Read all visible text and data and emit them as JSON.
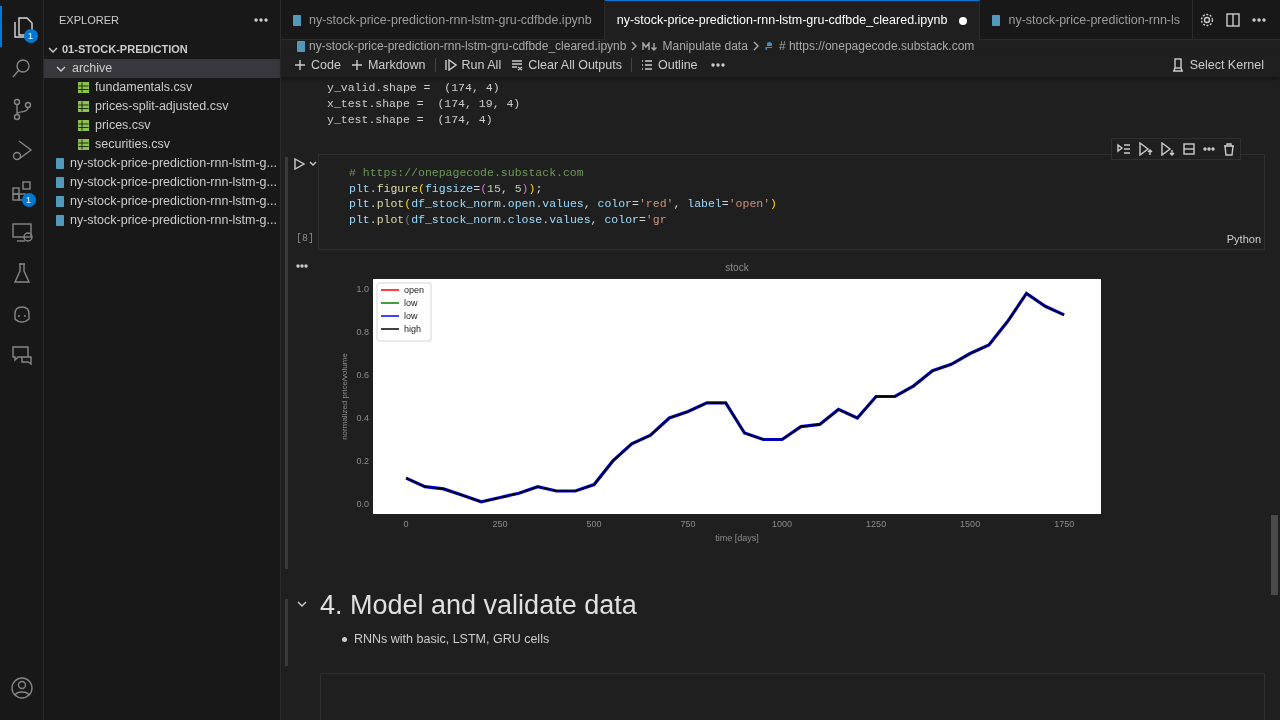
{
  "activity_bar": {
    "items": [
      {
        "kind": "files",
        "selected": true,
        "badge": "1"
      },
      {
        "kind": "search",
        "selected": false
      },
      {
        "kind": "source-control",
        "selected": false
      },
      {
        "kind": "run-debug",
        "selected": false
      },
      {
        "kind": "extensions",
        "selected": false,
        "badge": "1"
      },
      {
        "kind": "remote",
        "selected": false
      },
      {
        "kind": "testing",
        "selected": false
      },
      {
        "kind": "copilot",
        "selected": false
      },
      {
        "kind": "chat",
        "selected": false
      }
    ],
    "bottom": [
      {
        "kind": "account",
        "selected": false
      }
    ]
  },
  "sidebar": {
    "title": "EXPLORER",
    "folder": "01-STOCK-PREDICTION",
    "expanded": true,
    "items": [
      {
        "label": "archive",
        "kind": "folder",
        "expanded": true,
        "selected": true,
        "children": [
          {
            "label": "fundamentals.csv",
            "kind": "csv",
            "selected": false
          },
          {
            "label": "prices-split-adjusted.csv",
            "kind": "csv",
            "selected": false
          },
          {
            "label": "prices.csv",
            "kind": "csv",
            "selected": false
          },
          {
            "label": "securities.csv",
            "kind": "csv",
            "selected": false
          }
        ]
      },
      {
        "label": "ny-stock-price-prediction-rnn-lstm-g...",
        "kind": "notebook",
        "selected": false
      },
      {
        "label": "ny-stock-price-prediction-rnn-lstm-g...",
        "kind": "notebook",
        "selected": false
      },
      {
        "label": "ny-stock-price-prediction-rnn-lstm-g...",
        "kind": "notebook",
        "selected": false
      },
      {
        "label": "ny-stock-price-prediction-rnn-lstm-g...",
        "kind": "notebook",
        "selected": false
      }
    ]
  },
  "tabs": [
    {
      "label": "ny-stock-price-prediction-rnn-lstm-gru-cdfbde.ipynb",
      "selected": false,
      "dirty": false
    },
    {
      "label": "ny-stock-price-prediction-rnn-lstm-gru-cdfbde_cleared.ipynb",
      "selected": true,
      "dirty": true
    },
    {
      "label": "ny-stock-price-prediction-rnn-ls",
      "selected": false,
      "dirty": false
    }
  ],
  "breadcrumb": [
    {
      "label": "ny-stock-price-prediction-rnn-lstm-gru-cdfbde_cleared.ipynb",
      "kind": "notebook"
    },
    {
      "label": "Manipulate data",
      "kind": "markdown"
    },
    {
      "label": "# https://onepagecode.substack.com",
      "kind": "python"
    }
  ],
  "toolbar": {
    "items": [
      {
        "label": "Code",
        "kind": "add"
      },
      {
        "label": "Markdown",
        "kind": "add"
      },
      {
        "label": "Run All",
        "kind": "run"
      },
      {
        "label": "Clear All Outputs",
        "kind": "clear"
      },
      {
        "label": "Outline",
        "kind": "outline"
      }
    ],
    "kernel": "Select Kernel"
  },
  "previous_output": [
    "y_valid.shape =  (174, 4)",
    "x_test.shape =  (174, 19, 4)",
    "y_test.shape =  (174, 4)"
  ],
  "code_cell": {
    "execution_count": "[8]",
    "language": "Python",
    "lines": [
      [
        {
          "t": "# https://onepagecode.substack.com",
          "kind": "comment"
        }
      ],
      [
        {
          "t": "plt",
          "kind": "name"
        },
        {
          "t": ".",
          "kind": "punct"
        },
        {
          "t": "figure",
          "kind": "func"
        },
        {
          "t": "(",
          "kind": "bracket"
        },
        {
          "t": "figsize",
          "kind": "name"
        },
        {
          "t": "=",
          "kind": "punct"
        },
        {
          "t": "(",
          "kind": "bracket2"
        },
        {
          "t": "15",
          "kind": "number"
        },
        {
          "t": ", ",
          "kind": "punct"
        },
        {
          "t": "5",
          "kind": "number"
        },
        {
          "t": ")",
          "kind": "bracket2"
        },
        {
          "t": ")",
          "kind": "bracket"
        },
        {
          "t": ";",
          "kind": "punct"
        }
      ],
      [
        {
          "t": "plt",
          "kind": "name"
        },
        {
          "t": ".",
          "kind": "punct"
        },
        {
          "t": "plot",
          "kind": "func"
        },
        {
          "t": "(",
          "kind": "bracket"
        },
        {
          "t": "df_stock_norm",
          "kind": "name"
        },
        {
          "t": ".",
          "kind": "punct"
        },
        {
          "t": "open",
          "kind": "name"
        },
        {
          "t": ".",
          "kind": "punct"
        },
        {
          "t": "values",
          "kind": "name"
        },
        {
          "t": ", ",
          "kind": "punct"
        },
        {
          "t": "color",
          "kind": "name"
        },
        {
          "t": "=",
          "kind": "punct"
        },
        {
          "t": "'red'",
          "kind": "string"
        },
        {
          "t": ", ",
          "kind": "punct"
        },
        {
          "t": "label",
          "kind": "name"
        },
        {
          "t": "=",
          "kind": "punct"
        },
        {
          "t": "'open'",
          "kind": "string"
        },
        {
          "t": ")",
          "kind": "bracket"
        }
      ],
      [
        {
          "t": "plt",
          "kind": "name"
        },
        {
          "t": ".",
          "kind": "punct"
        },
        {
          "t": "plot",
          "kind": "func"
        },
        {
          "t": "(",
          "kind": "bracket_dim"
        },
        {
          "t": "df_stock_norm",
          "kind": "name"
        },
        {
          "t": ".",
          "kind": "punct"
        },
        {
          "t": "close",
          "kind": "name"
        },
        {
          "t": ".",
          "kind": "punct"
        },
        {
          "t": "values",
          "kind": "name"
        },
        {
          "t": ", ",
          "kind": "punct"
        },
        {
          "t": "color",
          "kind": "name"
        },
        {
          "t": "=",
          "kind": "punct"
        },
        {
          "t": "'gr",
          "kind": "string"
        }
      ]
    ]
  },
  "output": {
    "chart_data": {
      "type": "line",
      "title": "stock",
      "xlabel": "time [days]",
      "ylabel": "normalized price/volume",
      "x": [
        0,
        50,
        100,
        150,
        200,
        250,
        300,
        350,
        400,
        450,
        500,
        550,
        600,
        650,
        700,
        750,
        800,
        850,
        900,
        950,
        1000,
        1050,
        1100,
        1150,
        1200,
        1250,
        1300,
        1350,
        1400,
        1450,
        1500,
        1550,
        1600,
        1650,
        1700,
        1750
      ],
      "series": [
        {
          "name": "open",
          "color": "#ff0000",
          "values": [
            null,
            null,
            null,
            null,
            null,
            null,
            null,
            null,
            null,
            null,
            null,
            null,
            null,
            null,
            null,
            null,
            null,
            null,
            null,
            null,
            null,
            null,
            null,
            null,
            null,
            null,
            null,
            null,
            null,
            null,
            null,
            null,
            null,
            null,
            null,
            null
          ]
        },
        {
          "name": "low",
          "color": "#008000",
          "values": [
            null,
            null,
            null,
            null,
            null,
            null,
            null,
            null,
            null,
            null,
            null,
            null,
            null,
            null,
            null,
            null,
            null,
            null,
            null,
            null,
            null,
            null,
            null,
            null,
            null,
            null,
            null,
            null,
            null,
            null,
            null,
            null,
            null,
            null,
            null,
            null
          ]
        },
        {
          "name": "low",
          "color": "#0000ff",
          "values": [
            0.12,
            0.08,
            0.07,
            0.04,
            0.01,
            0.03,
            0.05,
            0.08,
            0.06,
            0.06,
            0.09,
            0.2,
            0.28,
            0.32,
            0.4,
            0.43,
            0.47,
            0.47,
            0.33,
            0.3,
            0.3,
            0.36,
            0.37,
            0.44,
            0.4,
            0.5,
            0.5,
            0.55,
            0.62,
            0.65,
            0.7,
            0.74,
            0.85,
            0.98,
            0.92,
            0.88
          ]
        },
        {
          "name": "high",
          "color": "#000000",
          "values": [
            0.12,
            0.08,
            0.07,
            0.04,
            0.01,
            0.03,
            0.05,
            0.08,
            0.06,
            0.06,
            0.09,
            0.2,
            0.28,
            0.32,
            0.4,
            0.43,
            0.47,
            0.47,
            0.33,
            0.3,
            0.3,
            0.36,
            0.37,
            0.44,
            0.4,
            0.5,
            0.5,
            0.55,
            0.62,
            0.65,
            0.7,
            0.74,
            0.85,
            0.98,
            0.92,
            0.88
          ]
        }
      ],
      "legend": "upper left",
      "xlim": [
        -88,
        1848
      ],
      "ylim": [
        -0.047,
        1.047
      ],
      "xticks": [
        0,
        250,
        500,
        750,
        1000,
        1250,
        1500,
        1750
      ],
      "yticks": [
        {
          "value": 0,
          "label": "0.0"
        },
        {
          "value": 0.2,
          "label": "0.2"
        },
        {
          "value": 0.4,
          "label": "0.4"
        },
        {
          "value": 0.6,
          "label": "0.6"
        },
        {
          "value": 0.8,
          "label": "0.8"
        },
        {
          "value": 1,
          "label": "1.0"
        }
      ]
    }
  },
  "markdown_cell": {
    "expanded": true,
    "heading": "4. Model and validate data",
    "bullets": [
      "RNNs with basic, LSTM, GRU cells"
    ]
  }
}
